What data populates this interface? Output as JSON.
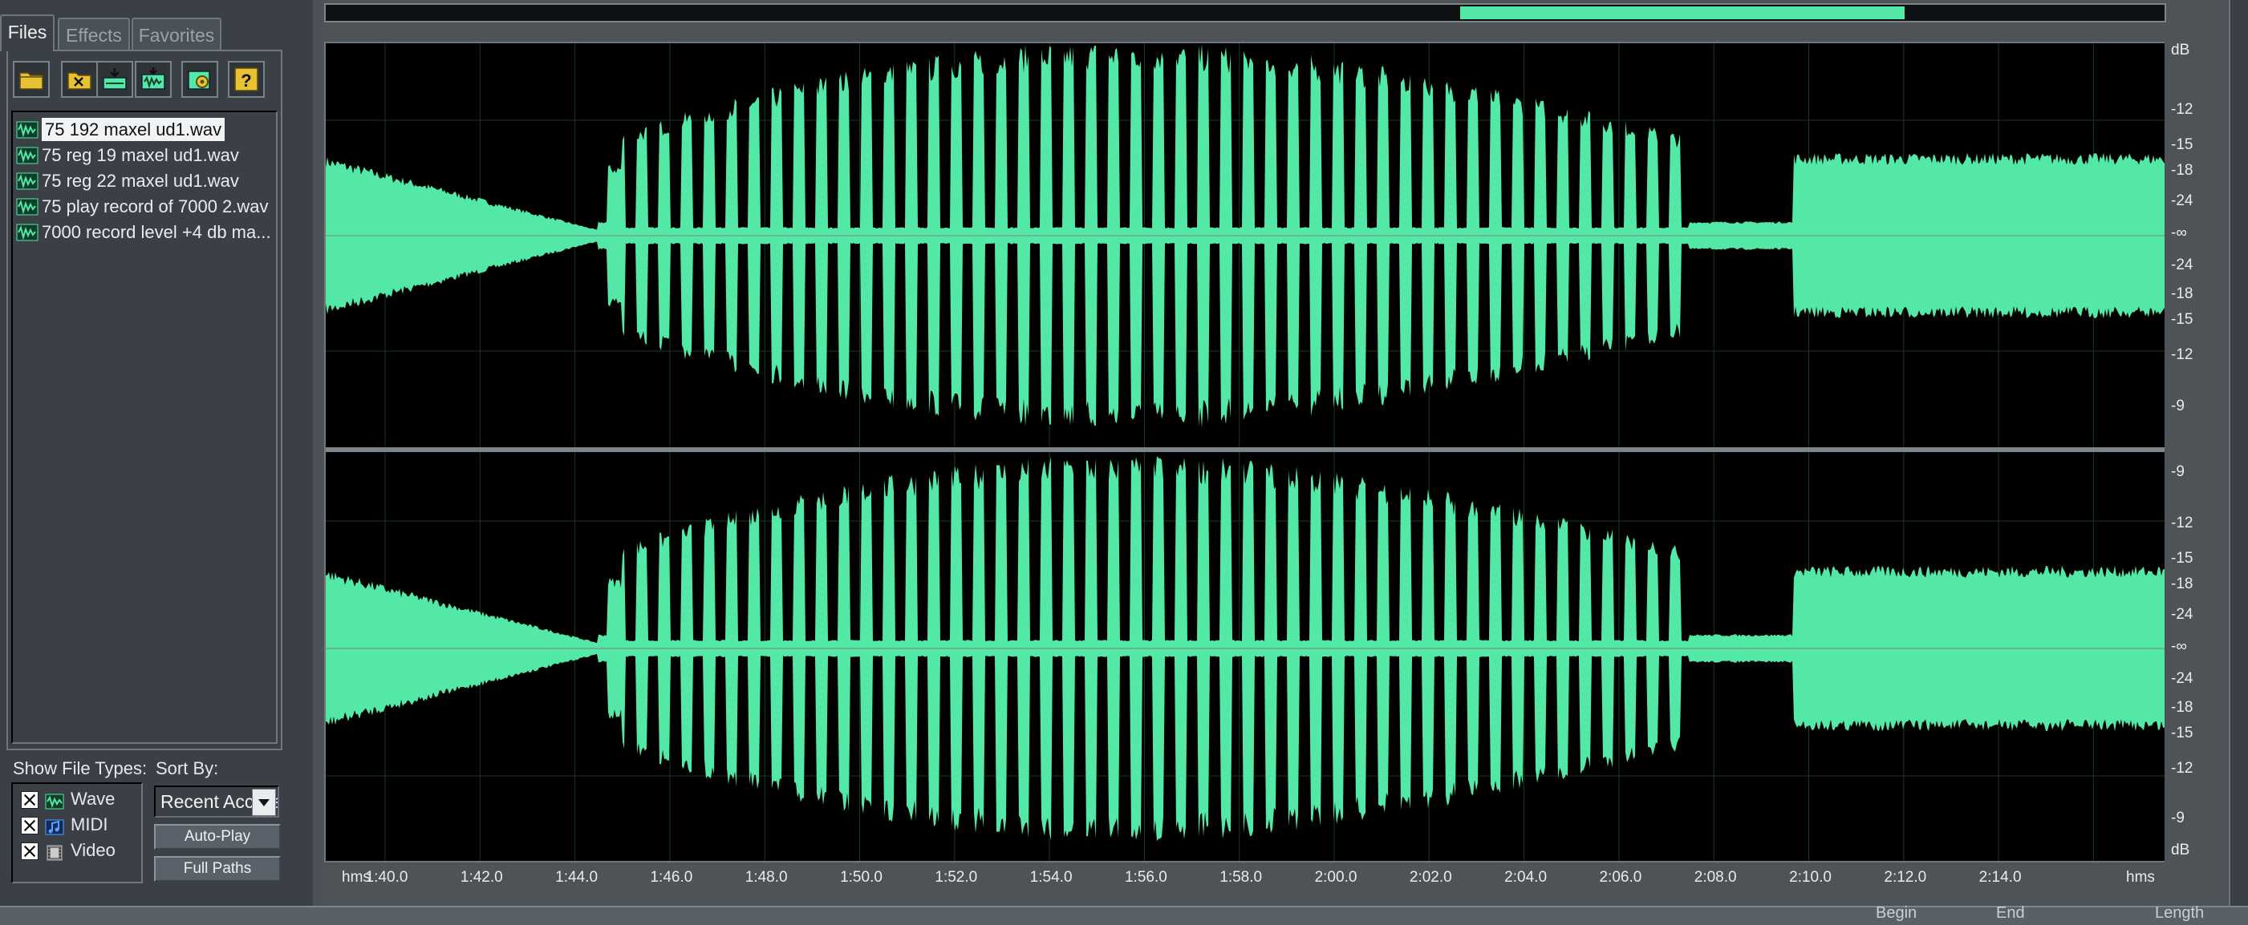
{
  "panel": {
    "tabs": [
      {
        "label": "Files"
      },
      {
        "label": "Effects"
      },
      {
        "label": "Favorites"
      }
    ],
    "files": [
      {
        "name": "75  192 maxel ud1.wav"
      },
      {
        "name": "75 reg 19 maxel ud1.wav"
      },
      {
        "name": "75 reg 22 maxel ud1.wav"
      },
      {
        "name": "75 play record of 7000 2.wav"
      },
      {
        "name": "7000 record level  +4 db ma..."
      }
    ],
    "show_types_label": "Show File Types:",
    "sort_by_label": "Sort By:",
    "file_types": [
      {
        "label": "Wave"
      },
      {
        "label": "MIDI"
      },
      {
        "label": "Video"
      }
    ],
    "sort_value": "Recent Access",
    "auto_play_label": "Auto-Play",
    "full_paths_label": "Full Paths"
  },
  "db_scale": {
    "top": [
      "dB",
      "-12",
      "-15",
      "-18",
      "-24",
      "-∞",
      "-24",
      "-18",
      "-15",
      "-12",
      "-9"
    ],
    "bottom": [
      "-9",
      "-12",
      "-15",
      "-18",
      "-24",
      "-∞",
      "-24",
      "-18",
      "-15",
      "-12",
      "-9",
      "dB"
    ]
  },
  "timeline": {
    "unit_left": "hms",
    "unit_right": "hms",
    "ticks": [
      "1:40.0",
      "1:42.0",
      "1:44.0",
      "1:46.0",
      "1:48.0",
      "1:50.0",
      "1:52.0",
      "1:54.0",
      "1:56.0",
      "1:58.0",
      "2:00.0",
      "2:02.0",
      "2:04.0",
      "2:06.0",
      "2:08.0",
      "2:10.0",
      "2:12.0",
      "2:14.0"
    ]
  },
  "status": {
    "begin_label": "Begin",
    "end_label": "End",
    "length_label": "Length"
  },
  "colors": {
    "waveform": "#54e8a7",
    "background": "#000000",
    "grid": "#163a1f"
  }
}
